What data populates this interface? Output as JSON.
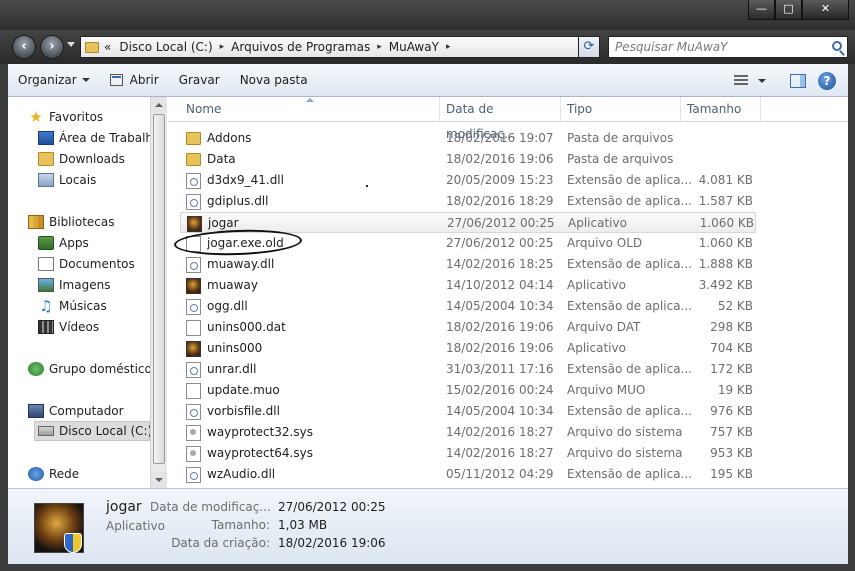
{
  "window": {
    "minimize_glyph": "—",
    "maximize_glyph": "□",
    "close_glyph": "✕"
  },
  "address": {
    "prefix": "«",
    "breadcrumbs": [
      "Disco Local (C:)",
      "Arquivos de Programas",
      "MuAwaY"
    ],
    "separator": "▸",
    "search_placeholder": "Pesquisar MuAwaY"
  },
  "toolbar": {
    "organize": "Organizar",
    "open": "Abrir",
    "burn": "Gravar",
    "new_folder": "Nova pasta",
    "help": "?"
  },
  "sidebar": {
    "items": [
      {
        "label": "Favoritos",
        "icon": "star-icon"
      },
      {
        "label": "Área de Trabalho",
        "icon": "desktop-icon"
      },
      {
        "label": "Downloads",
        "icon": "folder-icon"
      },
      {
        "label": "Locais",
        "icon": "places-icon"
      },
      {
        "label": "Bibliotecas",
        "icon": "libraries-icon"
      },
      {
        "label": "Apps",
        "icon": "apps-icon"
      },
      {
        "label": "Documentos",
        "icon": "documents-icon"
      },
      {
        "label": "Imagens",
        "icon": "pictures-icon"
      },
      {
        "label": "Músicas",
        "icon": "music-icon"
      },
      {
        "label": "Vídeos",
        "icon": "videos-icon"
      },
      {
        "label": "Grupo doméstico",
        "icon": "homegroup-icon"
      },
      {
        "label": "Computador",
        "icon": "computer-icon"
      },
      {
        "label": "Disco Local (C:)",
        "icon": "drive-icon"
      },
      {
        "label": "Rede",
        "icon": "network-icon"
      }
    ]
  },
  "columns": {
    "name": "Nome",
    "date": "Data de modificaç...",
    "type": "Tipo",
    "size": "Tamanho"
  },
  "files": [
    {
      "name": "Addons",
      "date": "18/02/2016 19:07",
      "type": "Pasta de arquivos",
      "size": "",
      "icon": "folder-icon"
    },
    {
      "name": "Data",
      "date": "18/02/2016 19:06",
      "type": "Pasta de arquivos",
      "size": "",
      "icon": "folder-icon"
    },
    {
      "name": "d3dx9_41.dll",
      "date": "20/05/2009 15:23",
      "type": "Extensão de aplica...",
      "size": "4.081 KB",
      "icon": "dll-icon"
    },
    {
      "name": "gdiplus.dll",
      "date": "18/02/2016 18:29",
      "type": "Extensão de aplica...",
      "size": "1.587 KB",
      "icon": "dll-icon"
    },
    {
      "name": "jogar",
      "date": "27/06/2012 00:25",
      "type": "Aplicativo",
      "size": "1.060 KB",
      "icon": "app-icon"
    },
    {
      "name": "jogar.exe.old",
      "date": "27/06/2012 00:25",
      "type": "Arquivo OLD",
      "size": "1.060 KB",
      "icon": "file-icon"
    },
    {
      "name": "muaway.dll",
      "date": "14/02/2016 18:25",
      "type": "Extensão de aplica...",
      "size": "1.888 KB",
      "icon": "dll-icon"
    },
    {
      "name": "muaway",
      "date": "14/10/2012 04:14",
      "type": "Aplicativo",
      "size": "3.492 KB",
      "icon": "app-icon"
    },
    {
      "name": "ogg.dll",
      "date": "14/05/2004 10:34",
      "type": "Extensão de aplica...",
      "size": "52 KB",
      "icon": "dll-icon"
    },
    {
      "name": "unins000.dat",
      "date": "18/02/2016 19:06",
      "type": "Arquivo DAT",
      "size": "298 KB",
      "icon": "file-icon"
    },
    {
      "name": "unins000",
      "date": "18/02/2016 19:06",
      "type": "Aplicativo",
      "size": "704 KB",
      "icon": "app-icon"
    },
    {
      "name": "unrar.dll",
      "date": "31/03/2011 17:16",
      "type": "Extensão de aplica...",
      "size": "172 KB",
      "icon": "dll-icon"
    },
    {
      "name": "update.muo",
      "date": "15/02/2016 00:24",
      "type": "Arquivo MUO",
      "size": "19 KB",
      "icon": "file-icon"
    },
    {
      "name": "vorbisfile.dll",
      "date": "14/05/2004 10:34",
      "type": "Extensão de aplica...",
      "size": "976 KB",
      "icon": "dll-icon"
    },
    {
      "name": "wayprotect32.sys",
      "date": "14/02/2016 18:27",
      "type": "Arquivo do sistema",
      "size": "757 KB",
      "icon": "sys-icon"
    },
    {
      "name": "wayprotect64.sys",
      "date": "14/02/2016 18:27",
      "type": "Arquivo do sistema",
      "size": "953 KB",
      "icon": "sys-icon"
    },
    {
      "name": "wzAudio.dll",
      "date": "05/11/2012 04:29",
      "type": "Extensão de aplica...",
      "size": "195 KB",
      "icon": "dll-icon"
    }
  ],
  "details": {
    "name": "jogar",
    "kind": "Aplicativo",
    "modified_label": "Data de modificaç...",
    "modified_value": "27/06/2012 00:25",
    "size_label": "Tamanho:",
    "size_value": "1,03 MB",
    "created_label": "Data da criação:",
    "created_value": "18/02/2016 19:06"
  }
}
